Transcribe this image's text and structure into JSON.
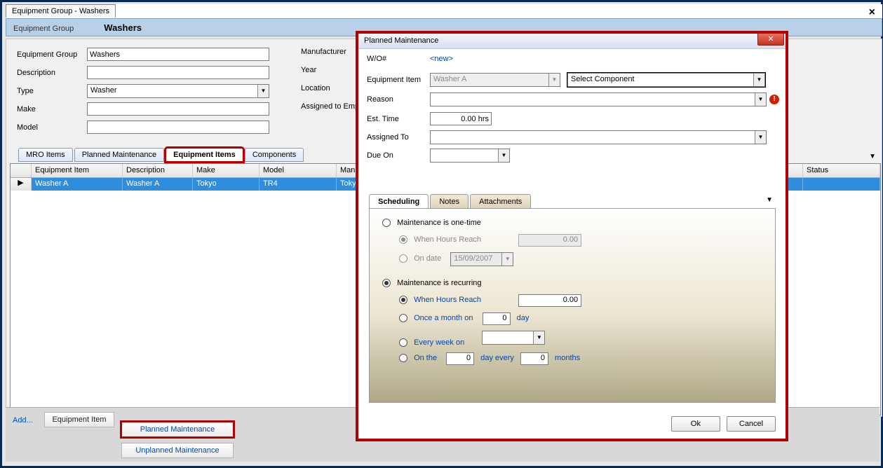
{
  "doc_tab": "Equipment Group - Washers",
  "subheader": {
    "label": "Equipment Group",
    "value": "Washers"
  },
  "form": {
    "labels": {
      "equipment_group": "Equipment Group",
      "description": "Description",
      "type": "Type",
      "make": "Make",
      "model": "Model",
      "manufacturer": "Manufacturer",
      "year": "Year",
      "location": "Location",
      "assigned_to": "Assigned to Emp"
    },
    "values": {
      "equipment_group": "Washers",
      "type": "Washer"
    }
  },
  "inner_tabs": [
    "MRO Items",
    "Planned Maintenance",
    "Equipment Items",
    "Components"
  ],
  "grid": {
    "headers": [
      "Equipment Item",
      "Description",
      "Make",
      "Model",
      "Manufacturer",
      "Status"
    ],
    "row": {
      "equipment_item": "Washer A",
      "description": "Washer A",
      "make": "Tokyo",
      "model": "TR4",
      "manufacturer": "Tokyo"
    }
  },
  "bottom": {
    "add": "Add...",
    "equipment_item": "Equipment Item",
    "planned": "Planned Maintenance",
    "unplanned": "Unplanned Maintenance"
  },
  "dialog": {
    "title": "Planned Maintenance",
    "labels": {
      "wo": "W/O#",
      "equipment_item": "Equipment Item",
      "reason": "Reason",
      "est_time": "Est. Time",
      "assigned_to": "Assigned To",
      "due_on": "Due On"
    },
    "values": {
      "wo": "<new>",
      "equipment_item": "Washer A",
      "component_placeholder": "Select Component",
      "est_time": "0.00 hrs"
    },
    "tabs": [
      "Scheduling",
      "Notes",
      "Attachments"
    ],
    "scheduling": {
      "one_time": "Maintenance is one-time",
      "when_hours": "When Hours Reach",
      "on_date": "On date",
      "on_date_value": "15/09/2007",
      "hours_disabled": "0.00",
      "recurring": "Maintenance is recurring",
      "rec_hours": "0.00",
      "once_month": "Once a month on",
      "once_month_val": "0",
      "day_suffix": "day",
      "every_week": "Every week on",
      "on_the": "On the",
      "on_the_val1": "0",
      "day_every": "day every",
      "on_the_val2": "0",
      "months_suffix": "months"
    },
    "buttons": {
      "ok": "Ok",
      "cancel": "Cancel"
    }
  }
}
